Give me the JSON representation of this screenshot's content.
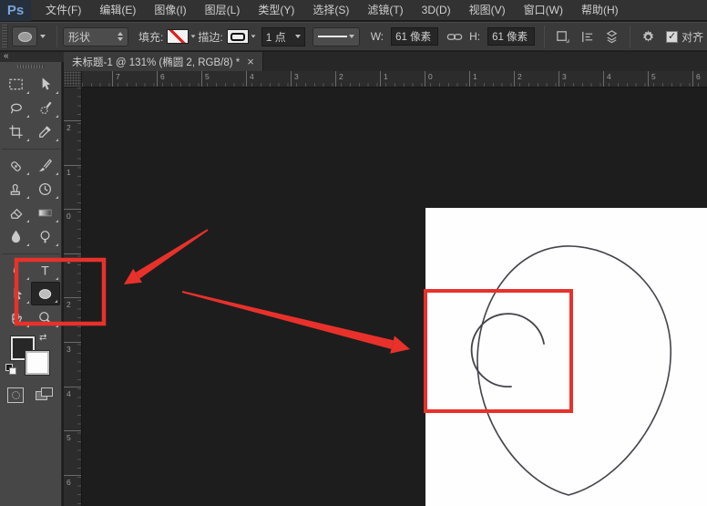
{
  "window": {
    "app_logo": "Ps"
  },
  "menu_bar": {
    "items": [
      "文件(F)",
      "编辑(E)",
      "图像(I)",
      "图层(L)",
      "类型(Y)",
      "选择(S)",
      "滤镜(T)",
      "3D(D)",
      "视图(V)",
      "窗口(W)",
      "帮助(H)"
    ]
  },
  "options_bar": {
    "tool_mode_label": "形状",
    "fill_label": "填充:",
    "stroke_label": "描边:",
    "stroke_width_value": "1 点",
    "width_label": "W:",
    "width_value": "61 像素",
    "height_label": "H:",
    "height_value": "61 像素",
    "align_edges_label": "对齐",
    "align_edges_checked": true,
    "check_glyph": "✓"
  },
  "tab_bar": {
    "collapse_glyph": "«",
    "active_tab": {
      "title": "未标题-1 @ 131% (椭圆 2, RGB/8) *",
      "close_glyph": "×"
    }
  },
  "toolbar": {
    "tools": [
      {
        "name": "rectangular-marquee"
      },
      {
        "name": "move"
      },
      {
        "name": "lasso"
      },
      {
        "name": "quick-selection"
      },
      {
        "name": "crop"
      },
      {
        "name": "eyedropper"
      },
      {
        "name": "spot-healing-brush"
      },
      {
        "name": "brush"
      },
      {
        "name": "clone-stamp"
      },
      {
        "name": "history-brush"
      },
      {
        "name": "eraser"
      },
      {
        "name": "gradient"
      },
      {
        "name": "blur"
      },
      {
        "name": "dodge"
      },
      {
        "name": "pen"
      },
      {
        "name": "type"
      },
      {
        "name": "path-selection"
      },
      {
        "name": "ellipse",
        "selected": true
      },
      {
        "name": "hand"
      },
      {
        "name": "zoom"
      }
    ],
    "separators_after_row": [
      3,
      7
    ],
    "swap_glyph": "⇄"
  },
  "rulers": {
    "horizontal_labels": [
      "7",
      "6",
      "5",
      "4",
      "3",
      "2",
      "1",
      "0",
      "1",
      "2",
      "3",
      "4",
      "5",
      "6"
    ],
    "vertical_labels": [
      "2",
      "1",
      "0",
      "1",
      "2",
      "3",
      "4",
      "5",
      "6"
    ]
  },
  "canvas": {
    "document_background": "#fefefe",
    "shapes": [
      "face-outline-egg",
      "ear-open-circle"
    ],
    "stroke_color": "#43434a"
  },
  "annotations": {
    "highlight_color": "#e8312b",
    "items": [
      "ellipse-tool-highlight-box",
      "arrow-to-ellipse-tool",
      "arrow-to-ear-region",
      "ear-region-highlight-box"
    ]
  },
  "colors": {
    "chrome": "#3a3a3a",
    "toolbar": "#474747",
    "pasteboard": "#1d1d1d",
    "logo_blue": "#7aa5da",
    "annotation_red": "#e8312b"
  }
}
